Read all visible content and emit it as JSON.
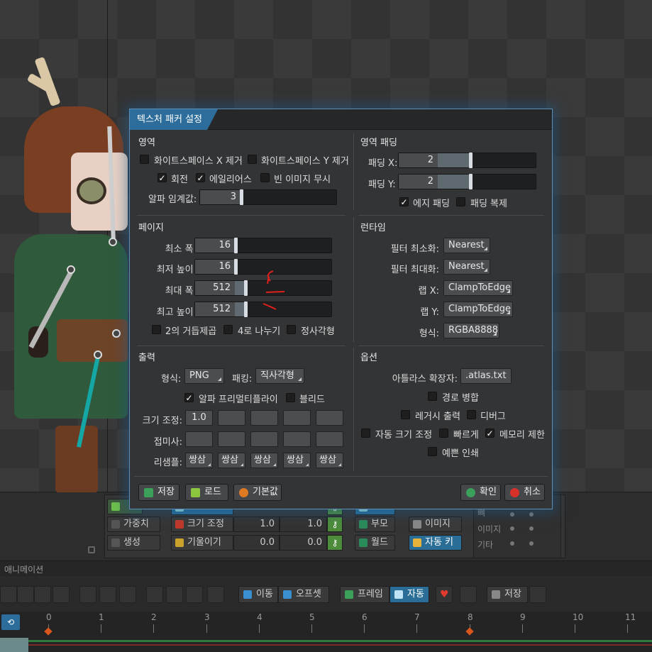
{
  "dialog": {
    "title": "텍스처 패커 설정",
    "region": {
      "title": "영역",
      "strip_ws_x": "화이트스페이스 X 제거",
      "strip_ws_y": "화이트스페이스 Y 제거",
      "rotation": "회전",
      "alias": "에일리어스",
      "ignore_blank": "빈 이미지 무시",
      "alpha_threshold_label": "알파 임계값:",
      "alpha_threshold_value": "3"
    },
    "region_padding": {
      "title": "영역 패딩",
      "pad_x_label": "패딩 X:",
      "pad_x_value": "2",
      "pad_y_label": "패딩 Y:",
      "pad_y_value": "2",
      "edge_padding": "에지 패딩",
      "duplicate_padding": "패딩 복제"
    },
    "pages": {
      "title": "페이지",
      "min_width_label": "최소 폭:",
      "min_width_value": "16",
      "min_height_label": "최저 높이:",
      "min_height_value": "16",
      "max_width_label": "최대 폭:",
      "max_width_value": "512",
      "max_height_label": "최고 높이:",
      "max_height_value": "512",
      "pot": "2의 거듭제곱",
      "div4": "4로 나누기",
      "square": "정사각형"
    },
    "runtime": {
      "title": "런타임",
      "filter_min_label": "필터 최소화:",
      "filter_min_value": "Nearest",
      "filter_mag_label": "필터 최대화:",
      "filter_mag_value": "Nearest",
      "wrap_x_label": "랩 X:",
      "wrap_x_value": "ClampToEdge",
      "wrap_y_label": "랩 Y:",
      "wrap_y_value": "ClampToEdge",
      "format_label": "형식:",
      "format_value": "RGBA8888"
    },
    "output": {
      "title": "출력",
      "format_label": "형식:",
      "format_value": "PNG",
      "packing_label": "패킹:",
      "packing_value": "직사각형",
      "premultiply": "알파 프리멀티플라이",
      "bleed": "블리드",
      "scale_label": "크기 조정:",
      "scale_values": [
        "1.0",
        "",
        "",
        "",
        ""
      ],
      "suffix_label": "접미사:",
      "suffix_values": [
        "",
        "",
        "",
        "",
        ""
      ],
      "resample_label": "리샘플:",
      "resample_values": [
        "쌍삼",
        "쌍삼",
        "쌍삼",
        "쌍삼",
        "쌍삼"
      ]
    },
    "options": {
      "title": "옵션",
      "atlas_ext_label": "아틀라스 확장자:",
      "atlas_ext_value": ".atlas.txt",
      "combine_subdirs": "경로 병합",
      "legacy_output": "레거시 출력",
      "debug": "디버그",
      "auto_scale": "자동 크기 조정",
      "fast": "빠르게",
      "limit_memory": "메모리 제한",
      "pretty_print": "예쁜 인쇄"
    },
    "buttons": {
      "save": "저장",
      "load": "로드",
      "defaults": "기본값",
      "ok": "확인",
      "cancel": "취소"
    }
  },
  "editor": {
    "tools": {
      "weights": "가중치",
      "create": "생성",
      "scale": "크기 조정",
      "scale_x": "1.0",
      "scale_y": "1.0",
      "shear": "기울이기",
      "shear_x": "0.0",
      "shear_y": "0.0",
      "parent": "부모",
      "world": "월드",
      "images": "이미지",
      "auto_key": "자동 키"
    },
    "side_labels": [
      "뼈",
      "이미지",
      "기타"
    ],
    "animation_label": "애니메이션",
    "timeline_buttons": {
      "move": "이동",
      "offset": "오프셋",
      "frame": "프레임",
      "auto": "자동",
      "save": "저장"
    },
    "timeline_numbers": [
      "0",
      "1",
      "2",
      "3",
      "4",
      "5",
      "6",
      "7",
      "8",
      "9",
      "10",
      "11"
    ]
  },
  "colors": {
    "accent": "#2c6d9c",
    "dialog_bg": "#333436",
    "keyframe": "#d9561c",
    "annotation": "#e0201c"
  }
}
